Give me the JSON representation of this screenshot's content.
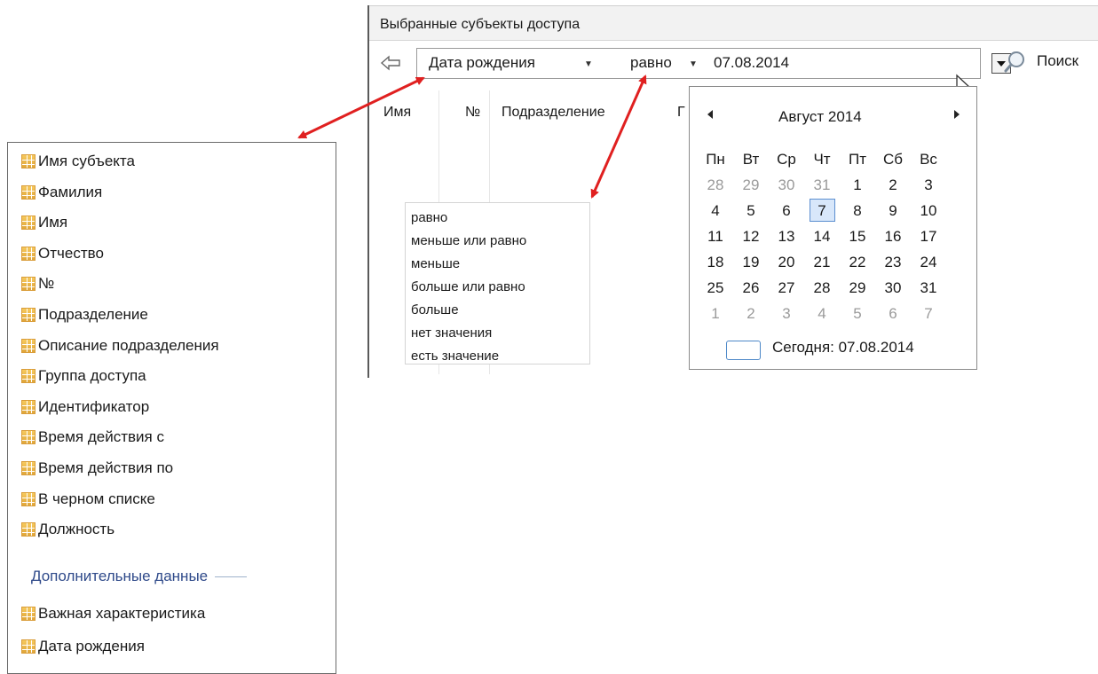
{
  "panel": {
    "title": "Выбранные субъекты доступа",
    "filter": {
      "field": "Дата рождения",
      "operator": "равно",
      "value": "07.08.2014"
    },
    "search_label": "Поиск",
    "grid_columns": [
      "Имя",
      "№",
      "Подразделение",
      "Г"
    ]
  },
  "operator_list": [
    "равно",
    "меньше или равно",
    "меньше",
    "больше или равно",
    "больше",
    "нет значения",
    "есть значение"
  ],
  "calendar": {
    "month_label": "Август 2014",
    "weekdays": [
      "Пн",
      "Вт",
      "Ср",
      "Чт",
      "Пт",
      "Сб",
      "Вс"
    ],
    "weeks": [
      [
        "28",
        "29",
        "30",
        "31",
        "1",
        "2",
        "3"
      ],
      [
        "4",
        "5",
        "6",
        "7",
        "8",
        "9",
        "10"
      ],
      [
        "11",
        "12",
        "13",
        "14",
        "15",
        "16",
        "17"
      ],
      [
        "18",
        "19",
        "20",
        "21",
        "22",
        "23",
        "24"
      ],
      [
        "25",
        "26",
        "27",
        "28",
        "29",
        "30",
        "31"
      ],
      [
        "1",
        "2",
        "3",
        "4",
        "5",
        "6",
        "7"
      ]
    ],
    "selected_day": "7",
    "today_label": "Сегодня: 07.08.2014"
  },
  "column_list": {
    "items": [
      "Имя субъекта",
      "Фамилия",
      "Имя",
      "Отчество",
      "№",
      "Подразделение",
      "Описание подразделения",
      "Группа доступа",
      "Идентификатор",
      "Время действия с",
      "Время действия по",
      "В черном списке",
      "Должность"
    ],
    "section_header": "Дополнительные данные",
    "extra_items": [
      "Важная характеристика",
      "Дата рождения"
    ]
  },
  "colors": {
    "arrow": "#e02020",
    "selected_day_bg": "#d8e7fa",
    "section_header": "#2f4a8a"
  }
}
